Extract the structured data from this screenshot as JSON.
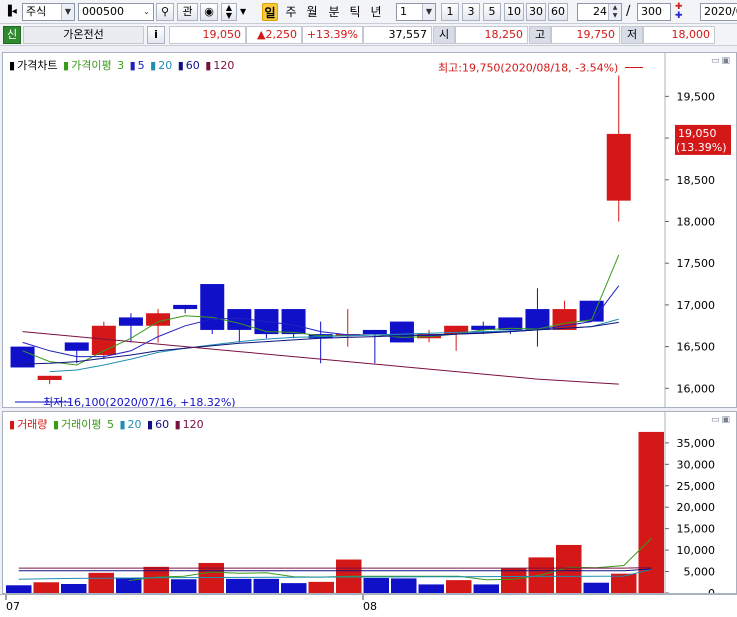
{
  "toolbar": {
    "market_type": "주식",
    "stock_code": "000500",
    "btn_gwan": "관",
    "period_tabs": [
      "일",
      "주",
      "월",
      "분",
      "틱",
      "년"
    ],
    "active_period": "일",
    "unit_value": "1",
    "quick_units": [
      "1",
      "3",
      "5",
      "10",
      "30",
      "60"
    ],
    "display_count": "24",
    "separator": "/",
    "total_count": "300",
    "date_value": "2020/0"
  },
  "quote": {
    "badge": "신",
    "stock_name": "가온전선",
    "info_btn": "i",
    "price": "19,050",
    "change": "▲2,250",
    "change_pct": "+13.39%",
    "volume": "37,557",
    "open_label": "시",
    "open": "18,250",
    "high_label": "고",
    "high": "19,750",
    "low_label": "저",
    "low": "18,000",
    "up_color": "#d41717",
    "down_color": "#1010c8"
  },
  "price_panel": {
    "legend": {
      "title": "가격차트",
      "ma_label": "가격이평",
      "ma_periods": [
        "3",
        "5",
        "20",
        "60",
        "120"
      ],
      "ma_colors": [
        "#3a9a1a",
        "#2020c0",
        "#1e8fb0",
        "#101080",
        "#7a1040"
      ]
    },
    "price_label": "19,050",
    "price_label_pct": "(13.39%)",
    "high_annotation": "최고:19,750(2020/08/18, -3.54%)",
    "low_annotation": "최저:16,100(2020/07/16, +18.32%)"
  },
  "volume_panel": {
    "legend": {
      "title": "거래량",
      "ma_label": "거래이평",
      "ma_periods": [
        "5",
        "20",
        "60",
        "120"
      ],
      "ma_colors": [
        "#3a9a1a",
        "#1e8fb0",
        "#101080",
        "#7a1040"
      ]
    }
  },
  "x_axis": {
    "labels": [
      "07",
      "08"
    ]
  },
  "chart_data": [
    {
      "type": "candlestick",
      "title": "가격차트",
      "y_ticks": [
        16000,
        16500,
        17000,
        17500,
        18000,
        18500,
        19000,
        19500
      ],
      "ylim": [
        15800,
        19900
      ],
      "candles": [
        {
          "o": 16500,
          "h": 16500,
          "l": 16250,
          "c": 16250
        },
        {
          "o": 16100,
          "h": 16150,
          "l": 16050,
          "c": 16150
        },
        {
          "o": 16550,
          "h": 16550,
          "l": 16300,
          "c": 16450
        },
        {
          "o": 16400,
          "h": 16800,
          "l": 16350,
          "c": 16750
        },
        {
          "o": 16850,
          "h": 16900,
          "l": 16550,
          "c": 16750
        },
        {
          "o": 16750,
          "h": 16950,
          "l": 16550,
          "c": 16900
        },
        {
          "o": 17000,
          "h": 17000,
          "l": 16900,
          "c": 16950
        },
        {
          "o": 17250,
          "h": 17250,
          "l": 16650,
          "c": 16700
        },
        {
          "o": 16950,
          "h": 16950,
          "l": 16550,
          "c": 16700
        },
        {
          "o": 16950,
          "h": 16950,
          "l": 16600,
          "c": 16650
        },
        {
          "o": 16950,
          "h": 16950,
          "l": 16600,
          "c": 16650
        },
        {
          "o": 16650,
          "h": 16800,
          "l": 16300,
          "c": 16600
        },
        {
          "o": 16650,
          "h": 16950,
          "l": 16500,
          "c": 16650
        },
        {
          "o": 16700,
          "h": 16700,
          "l": 16300,
          "c": 16650
        },
        {
          "o": 16800,
          "h": 16800,
          "l": 16550,
          "c": 16550
        },
        {
          "o": 16600,
          "h": 16700,
          "l": 16550,
          "c": 16650
        },
        {
          "o": 16650,
          "h": 16750,
          "l": 16450,
          "c": 16750
        },
        {
          "o": 16750,
          "h": 16800,
          "l": 16650,
          "c": 16700
        },
        {
          "o": 16850,
          "h": 16850,
          "l": 16650,
          "c": 16700
        },
        {
          "o": 16950,
          "h": 17200,
          "l": 16500,
          "c": 16700
        },
        {
          "o": 16700,
          "h": 17050,
          "l": 16700,
          "c": 16950
        },
        {
          "o": 17050,
          "h": 17050,
          "l": 16800,
          "c": 16800
        },
        {
          "o": 18250,
          "h": 19750,
          "l": 18000,
          "c": 19050
        }
      ],
      "ma": {
        "3": [
          16450,
          16320,
          16280,
          16450,
          16600,
          16800,
          16870,
          16850,
          16780,
          16680,
          16670,
          16630,
          16630,
          16640,
          16610,
          16620,
          16650,
          16700,
          16720,
          16710,
          16780,
          16820,
          17600
        ],
        "5": [
          16550,
          16450,
          16380,
          16380,
          16450,
          16620,
          16750,
          16830,
          16840,
          16800,
          16760,
          16680,
          16640,
          16640,
          16640,
          16630,
          16650,
          16670,
          16680,
          16700,
          16750,
          16800,
          17230
        ],
        "20": [
          null,
          16200,
          16220,
          16280,
          16350,
          16430,
          16480,
          16520,
          16560,
          16590,
          16610,
          16620,
          16630,
          16640,
          16650,
          16660,
          16670,
          16680,
          16690,
          16700,
          16720,
          16740,
          16830
        ],
        "60": [
          16290,
          16300,
          16320,
          16360,
          16400,
          16450,
          16480,
          16510,
          16540,
          16560,
          16580,
          16600,
          16610,
          16620,
          16630,
          16640,
          16650,
          16660,
          16680,
          16700,
          16720,
          16740,
          16790
        ],
        "120": [
          16680,
          16650,
          16620,
          16590,
          16560,
          16530,
          16500,
          16470,
          16440,
          16410,
          16380,
          16350,
          16320,
          16290,
          16260,
          16230,
          16200,
          16170,
          16140,
          16110,
          16090,
          16070,
          16050
        ]
      }
    },
    {
      "type": "bar",
      "title": "거래량",
      "y_ticks": [
        0,
        5000,
        10000,
        15000,
        20000,
        25000,
        30000,
        35000
      ],
      "ylim": [
        0,
        38000
      ],
      "values": [
        1800,
        2500,
        2100,
        4700,
        3600,
        6100,
        3200,
        7000,
        3300,
        3300,
        2300,
        2600,
        7800,
        3500,
        3400,
        2000,
        3000,
        2000,
        5700,
        8300,
        11200,
        2400,
        4500,
        37557
      ],
      "up": [
        false,
        true,
        false,
        true,
        false,
        true,
        false,
        true,
        false,
        false,
        false,
        true,
        true,
        false,
        false,
        false,
        true,
        false,
        true,
        true,
        true,
        false,
        true,
        true
      ],
      "ma": {
        "5": [
          null,
          null,
          null,
          null,
          2900,
          3700,
          3900,
          4900,
          4600,
          4700,
          3800,
          3700,
          3900,
          3900,
          3900,
          3900,
          3900,
          3100,
          3200,
          4200,
          6000,
          5900,
          6400,
          12700
        ],
        "20": [
          3200,
          3300,
          3400,
          3450,
          3500,
          3550,
          3600,
          3620,
          3640,
          3660,
          3680,
          3700,
          3720,
          3740,
          3760,
          3780,
          3800,
          3820,
          3840,
          3860,
          3880,
          3900,
          3950,
          5500
        ],
        "60": [
          5200,
          5200,
          5200,
          5200,
          5200,
          5200,
          5200,
          5200,
          5200,
          5200,
          5200,
          5200,
          5200,
          5200,
          5200,
          5200,
          5200,
          5200,
          5200,
          5200,
          5200,
          5200,
          5200,
          5600
        ],
        "120": [
          5800,
          5800,
          5800,
          5800,
          5800,
          5800,
          5800,
          5800,
          5800,
          5800,
          5800,
          5800,
          5800,
          5800,
          5800,
          5800,
          5800,
          5800,
          5800,
          5800,
          5800,
          5800,
          5800,
          5900
        ]
      }
    }
  ]
}
